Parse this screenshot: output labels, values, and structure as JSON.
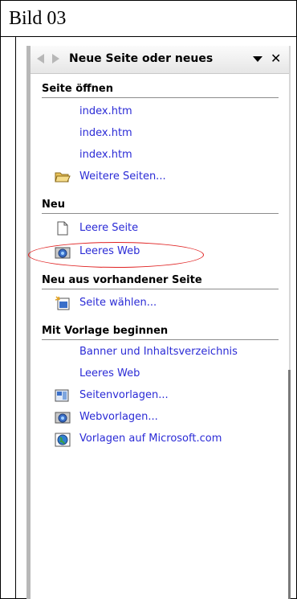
{
  "caption": "Bild 03",
  "pane": {
    "title": "Neue Seite oder neues",
    "sections": {
      "open": {
        "heading": "Seite öffnen",
        "items": [
          "index.htm",
          "index.htm",
          "index.htm",
          "Weitere Seiten..."
        ]
      },
      "new": {
        "heading": "Neu",
        "items": [
          "Leere Seite",
          "Leeres Web"
        ]
      },
      "from_existing": {
        "heading": "Neu aus vorhandener Seite",
        "items": [
          "Seite wählen..."
        ]
      },
      "template": {
        "heading": "Mit Vorlage beginnen",
        "items": [
          "Banner und Inhaltsverzeichnis",
          "Leeres Web",
          "Seitenvorlagen...",
          "Webvorlagen...",
          "Vorlagen auf Microsoft.com"
        ]
      }
    }
  },
  "icons": {
    "back": "back-arrow-icon",
    "forward": "forward-arrow-icon",
    "dropdown": "dropdown-icon",
    "close": "close-icon",
    "folder": "open-folder-icon",
    "blank_page": "blank-page-icon",
    "web": "web-icon",
    "choose_page": "choose-page-icon",
    "page_templates": "page-templates-icon",
    "web_templates": "web-templates-icon",
    "globe": "globe-icon"
  },
  "colors": {
    "link": "#2b2bd6",
    "highlight_ellipse": "#e02222"
  }
}
